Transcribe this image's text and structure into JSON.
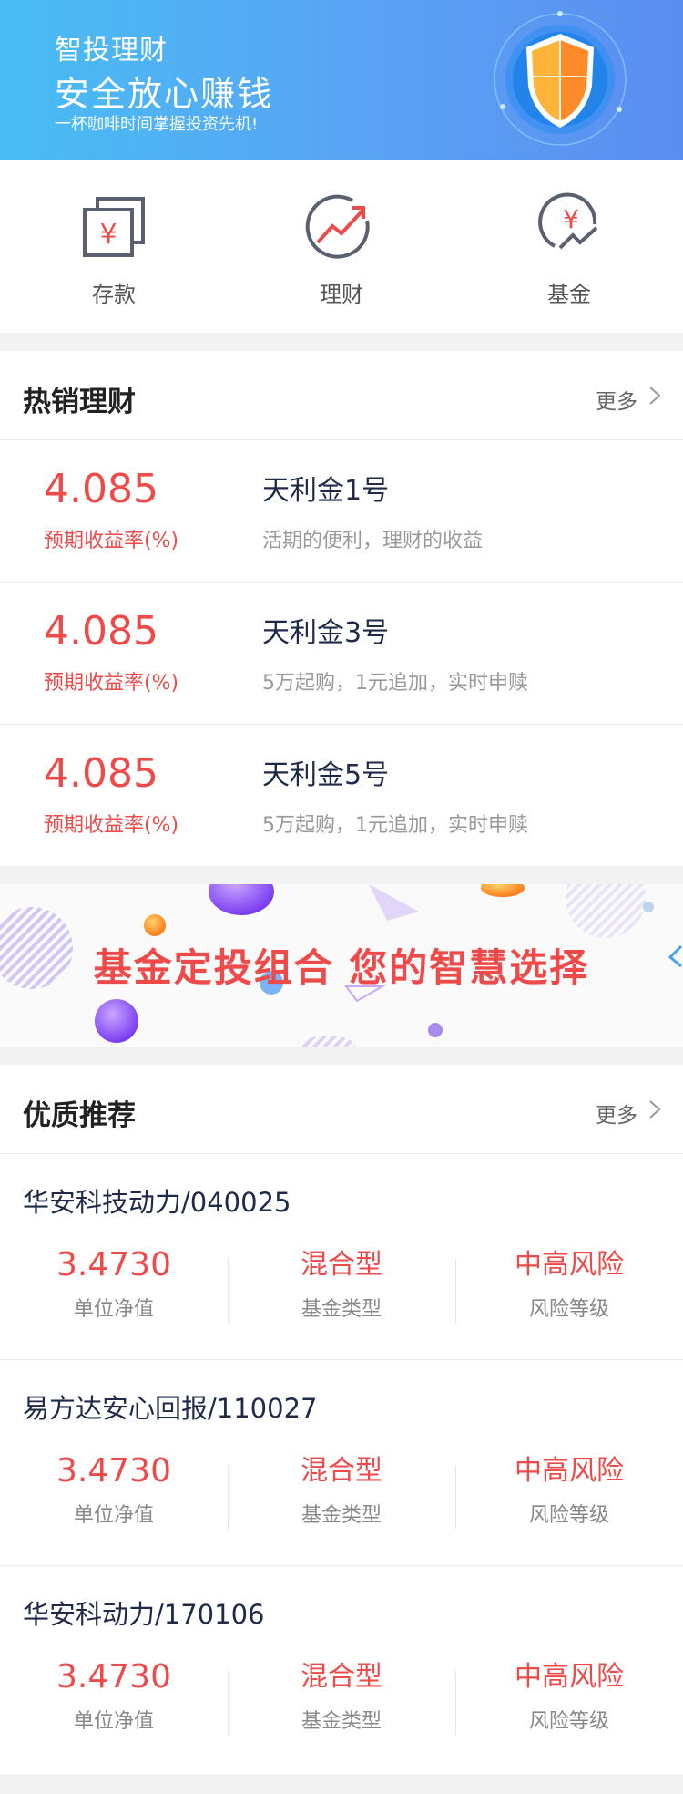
{
  "hero": {
    "line1": "智投理财",
    "line2": "安全放心赚钱",
    "line3": "一杯咖啡时间掌握投资先机!"
  },
  "quick_entries": [
    {
      "label": "存款",
      "icon": "deposit-yen-icon"
    },
    {
      "label": "理财",
      "icon": "trend-chart-icon"
    },
    {
      "label": "基金",
      "icon": "fund-yen-cycle-icon"
    }
  ],
  "hot": {
    "title": "热销理财",
    "more": "更多",
    "items": [
      {
        "rate": "4.085",
        "rate_label": "预期收益率(%)",
        "name": "天利金1号",
        "desc": "活期的便利，理财的收益"
      },
      {
        "rate": "4.085",
        "rate_label": "预期收益率(%)",
        "name": "天利金3号",
        "desc": "5万起购，1元追加，实时申赎"
      },
      {
        "rate": "4.085",
        "rate_label": "预期收益率(%)",
        "name": "天利金5号",
        "desc": "5万起购，1元追加，实时申赎"
      }
    ]
  },
  "ad": {
    "slogan": "基金定投组合  您的智慧选择"
  },
  "recommend": {
    "title": "优质推荐",
    "more": "更多",
    "items": [
      {
        "name": "华安科技动力/040025",
        "nav": "3.4730",
        "nav_label": "单位净值",
        "type": "混合型",
        "type_label": "基金类型",
        "risk": "中高风险",
        "risk_label": "风险等级"
      },
      {
        "name": "易方达安心回报/110027",
        "nav": "3.4730",
        "nav_label": "单位净值",
        "type": "混合型",
        "type_label": "基金类型",
        "risk": "中高风险",
        "risk_label": "风险等级"
      },
      {
        "name": "华安科动力/170106",
        "nav": "3.4730",
        "nav_label": "单位净值",
        "type": "混合型",
        "type_label": "基金类型",
        "risk": "中高风险",
        "risk_label": "风险等级"
      }
    ]
  },
  "colors": {
    "accent_red": "#ef4a4a",
    "hero_blue": "#5aa2f4",
    "title_navy": "#1f2a4a"
  }
}
